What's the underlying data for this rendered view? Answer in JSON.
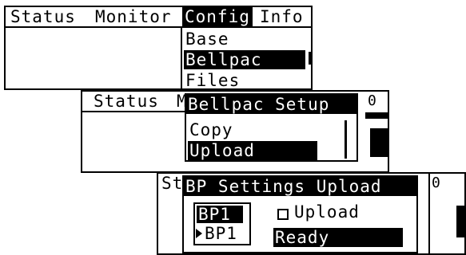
{
  "screen1": {
    "menu": [
      "Status",
      "Monitor",
      "Config",
      "Info"
    ],
    "dropdown": [
      "Base",
      "Bellpac",
      "Files"
    ],
    "selected_index": 1
  },
  "screen2": {
    "menu_partial": [
      "Status",
      "M"
    ],
    "popup_title": "Bellpac Setup",
    "popup_items": [
      "Copy",
      "Upload"
    ],
    "right_label": "0"
  },
  "screen3": {
    "menu_partial": "St",
    "popup_title": "BP Settings Upload",
    "list_items": [
      "BP1",
      "BP1"
    ],
    "checkbox_label": "Upload",
    "status": "Ready",
    "right_label": "0"
  }
}
